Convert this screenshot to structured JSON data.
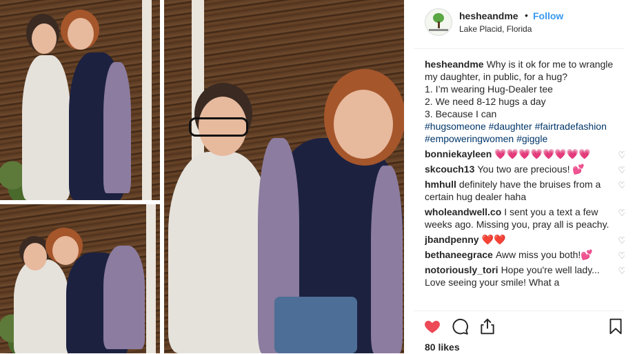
{
  "post": {
    "username": "hesheandme",
    "separator": "•",
    "follow_label": "Follow",
    "location": "Lake Placid, Florida"
  },
  "caption": {
    "username": "hesheandme",
    "line1": "Why is it ok for me to wrangle my daughter, in public, for a hug?",
    "line2": "1. I’m wearing Hug-Dealer tee",
    "line3": "2. We need 8-12 hugs a day",
    "line4": "3. Because I can",
    "hashtags": [
      "#hugsomeone",
      "#daughter",
      "#fairtradefashion",
      "#empoweringwomen",
      "#giggle"
    ]
  },
  "comments": [
    {
      "user": "bonniekayleen",
      "text": "💗💗💗💗💗💗💗💗"
    },
    {
      "user": "skcouch13",
      "text": "You two are precious! 💕"
    },
    {
      "user": "hmhull",
      "text": "definitely have the bruises from a certain hug dealer haha"
    },
    {
      "user": "wholeandwell.co",
      "text": "I sent you a text a few weeks ago. Missing you, pray all is peachy."
    },
    {
      "user": "jbandpenny",
      "text": "❤️❤️"
    },
    {
      "user": "bethaneegrace",
      "text": "Aww miss you both!💕"
    },
    {
      "user": "notoriously_tori",
      "text": "Hope you're well lady... Love seeing your smile! What a"
    }
  ],
  "actions": {
    "like_icon": "heart-filled-icon",
    "comment_icon": "comment-bubble-icon",
    "share_icon": "share-icon",
    "save_icon": "bookmark-icon",
    "like_color": "#ed4956"
  },
  "likes": "80 likes",
  "colors": {
    "link": "#3897f0",
    "hashtag": "#003569",
    "text": "#262626"
  }
}
